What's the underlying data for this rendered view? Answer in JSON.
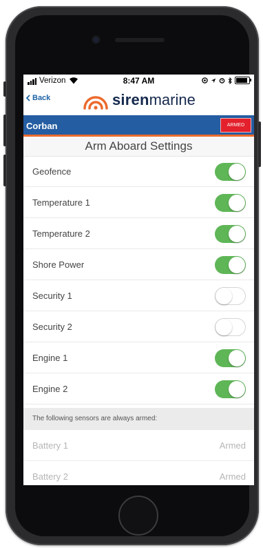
{
  "status_bar": {
    "carrier": "Verizon",
    "time": "8:47 AM"
  },
  "nav": {
    "back_label": "Back",
    "logo_bold": "siren",
    "logo_light": "marine"
  },
  "boat_bar": {
    "boat_name": "Corban",
    "armed_badge": "ARMED"
  },
  "page_title": "Arm Aboard Settings",
  "settings": [
    {
      "label": "Geofence",
      "on": true
    },
    {
      "label": "Temperature 1",
      "on": true
    },
    {
      "label": "Temperature 2",
      "on": true
    },
    {
      "label": "Shore Power",
      "on": true
    },
    {
      "label": "Security 1",
      "on": false
    },
    {
      "label": "Security 2",
      "on": false
    },
    {
      "label": "Engine 1",
      "on": true
    },
    {
      "label": "Engine 2",
      "on": true
    }
  ],
  "always_armed": {
    "header": "The following sensors are always armed:",
    "items": [
      {
        "label": "Battery 1",
        "value": "Armed"
      },
      {
        "label": "Battery 2",
        "value": "Armed"
      }
    ]
  },
  "colors": {
    "toggle_on": "#5fb657",
    "brand_blue": "#245da2",
    "brand_orange": "#ec6a2d",
    "armed_red": "#e3202b"
  },
  "icons": [
    "signal-bars-icon",
    "wifi-icon",
    "location-icon",
    "alarm-icon",
    "bluetooth-icon",
    "battery-icon",
    "chevron-left-icon",
    "siren-logo-icon"
  ]
}
